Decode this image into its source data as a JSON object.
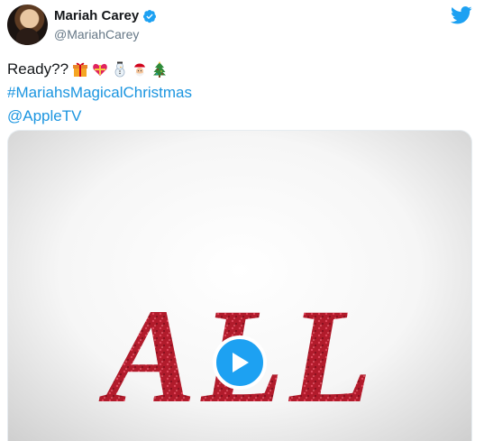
{
  "author": {
    "name": "Mariah Carey",
    "handle": "@MariahCarey",
    "verified": true
  },
  "tweet": {
    "line1_text": "Ready??",
    "emojis": [
      "wrapped-gift",
      "heart-with-ribbon",
      "snowman",
      "santa-claus",
      "christmas-tree"
    ],
    "hashtag": "#MariahsMagicalChristmas",
    "mention": "@AppleTV"
  },
  "media": {
    "type": "video",
    "title_text": "ALL",
    "title_color": "#b11b2b"
  },
  "colors": {
    "link": "#1b95e0",
    "twitter_blue": "#1da1f2",
    "handle_gray": "#657786"
  }
}
